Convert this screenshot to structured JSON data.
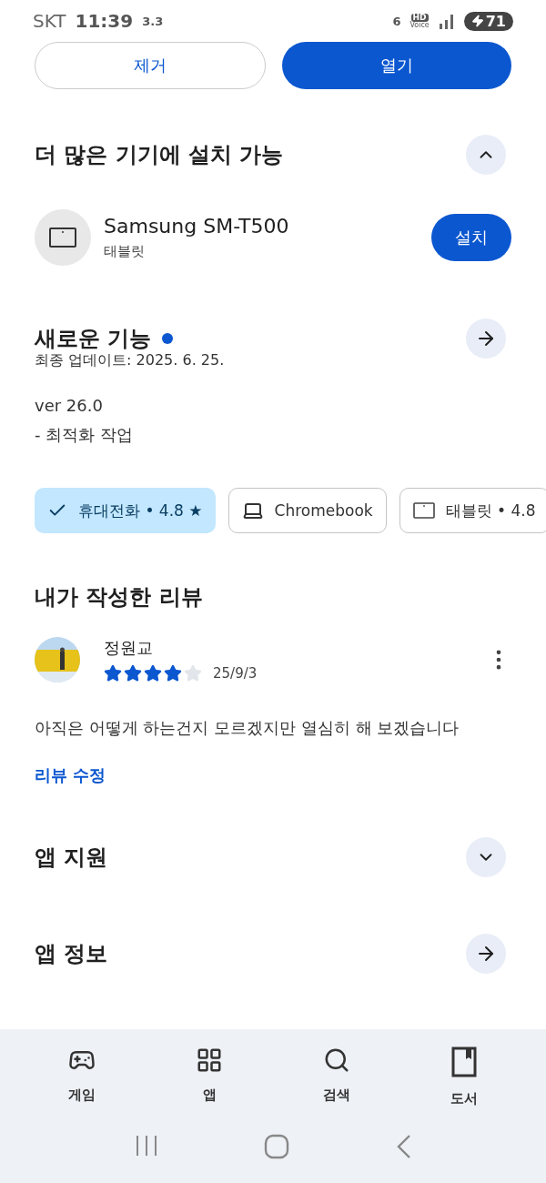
{
  "status_bar": {
    "carrier": "SKT",
    "time": "11:39",
    "speed": "3.3",
    "wifi_badge": "6",
    "hd": "HD",
    "voice": "Voice",
    "battery": "71"
  },
  "top_buttons": [
    {
      "label": "제거",
      "kind": "outline"
    },
    {
      "label": "열기",
      "kind": "filled"
    }
  ],
  "install_section": {
    "title": "더 많은 기기에 설치 가능",
    "expanded": true,
    "devices": [
      {
        "name": "Samsung SM-T500",
        "type": "태블릿",
        "button": "설치"
      }
    ]
  },
  "whats_new": {
    "title": "새로운 기능",
    "new": true,
    "updated": "최종 업데이트: 2025. 6. 25.",
    "notes": [
      "ver 26.0",
      "- 최적화 작업"
    ]
  },
  "chips": [
    {
      "kind": "phone",
      "label": "휴대전화 • 4.8 ★",
      "selected": true
    },
    {
      "kind": "laptop",
      "label": "Chromebook",
      "selected": false
    },
    {
      "kind": "tablet",
      "label": "태블릿 • 4.8",
      "selected": false
    }
  ],
  "my_review": {
    "title": "내가 작성한 리뷰",
    "author": "정원교",
    "stars": 4,
    "date": "25/9/3",
    "text": "아직은 어떻게 하는건지 모르겠지만 열심히 해 보겠습니다",
    "edit_link": "리뷰 수정"
  },
  "sections": [
    {
      "title": "앱 지원",
      "kind": "expand"
    },
    {
      "title": "앱 정보",
      "kind": "arrow"
    }
  ],
  "bottom_nav": [
    {
      "kind": "games",
      "label": "게임"
    },
    {
      "kind": "apps",
      "label": "앱"
    },
    {
      "kind": "search",
      "label": "검색"
    },
    {
      "kind": "books",
      "label": "도서"
    }
  ]
}
